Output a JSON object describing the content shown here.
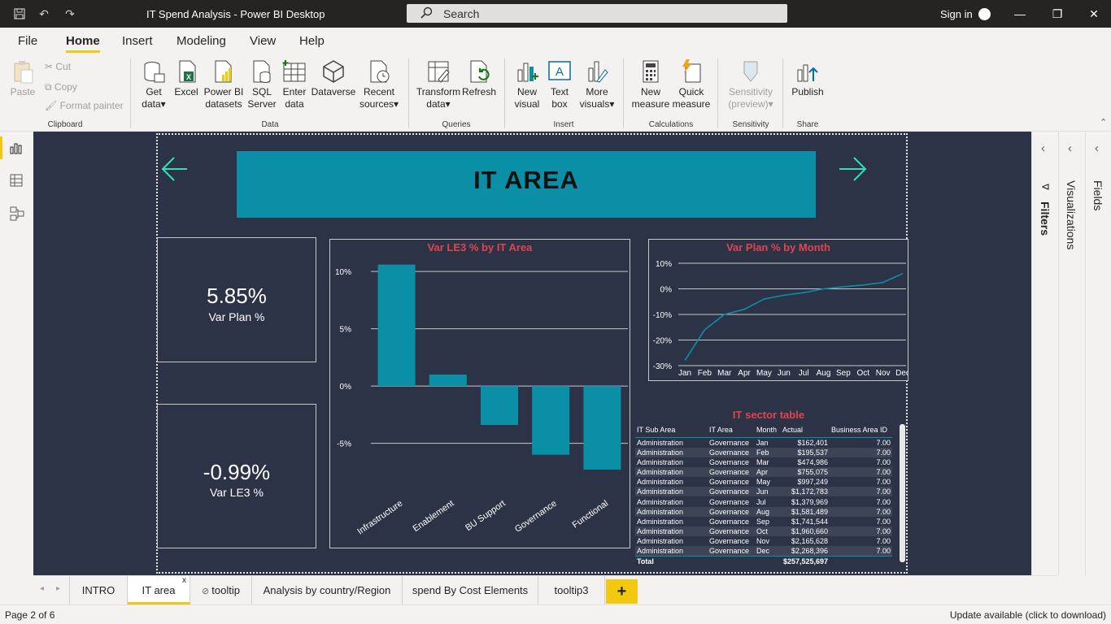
{
  "titlebar": {
    "title": "IT Spend Analysis - Power BI Desktop",
    "search_label": "Search",
    "signin_label": "Sign in"
  },
  "menu": {
    "tabs": [
      "File",
      "Home",
      "Insert",
      "Modeling",
      "View",
      "Help"
    ],
    "active": "Home"
  },
  "ribbon": {
    "clipboard": {
      "paste": "Paste",
      "cut": "Cut",
      "copy": "Copy",
      "format_painter": "Format painter",
      "group": "Clipboard"
    },
    "data": {
      "get_data": "Get data",
      "excel": "Excel",
      "pbi_datasets": "Power BI datasets",
      "sql_server": "SQL Server",
      "enter_data": "Enter data",
      "dataverse": "Dataverse",
      "recent_sources": "Recent sources",
      "group": "Data"
    },
    "queries": {
      "transform_data": "Transform data",
      "refresh": "Refresh",
      "group": "Queries"
    },
    "insert": {
      "new_visual": "New visual",
      "text_box": "Text box",
      "more_visuals": "More visuals",
      "group": "Insert"
    },
    "calculations": {
      "new_measure": "New measure",
      "quick_measure": "Quick measure",
      "group": "Calculations"
    },
    "sensitivity": {
      "label": "Sensitivity (preview)",
      "group": "Sensitivity"
    },
    "share": {
      "publish": "Publish",
      "group": "Share"
    }
  },
  "report": {
    "header_title": "IT AREA",
    "card1": {
      "value": "5.85%",
      "label": "Var Plan %"
    },
    "card2": {
      "value": "-0.99%",
      "label": "Var LE3 %"
    },
    "bar_title": "Var LE3 % by IT Area",
    "line_title": "Var Plan % by Month",
    "table_title": "IT  sector table",
    "accent_color": "#0b8fa6",
    "title_color": "#e0444e"
  },
  "chart_data": [
    {
      "type": "bar",
      "title": "Var LE3 % by IT Area",
      "categories": [
        "Infrastructure",
        "Enablement",
        "BU Support",
        "Governance",
        "Functional"
      ],
      "values": [
        10.6,
        1.0,
        -3.4,
        -6.0,
        -7.3
      ],
      "y_ticks": [
        "10%",
        "5%",
        "0%",
        "-5%"
      ],
      "ylim": [
        -9,
        11
      ]
    },
    {
      "type": "line",
      "title": "Var Plan % by Month",
      "categories": [
        "Jan",
        "Feb",
        "Mar",
        "Apr",
        "May",
        "Jun",
        "Jul",
        "Aug",
        "Sep",
        "Oct",
        "Nov",
        "Dec"
      ],
      "values": [
        -28,
        -16,
        -10,
        -8,
        -4,
        -2.5,
        -1.5,
        0,
        0.8,
        1.5,
        2.5,
        6
      ],
      "y_ticks": [
        "10%",
        "0%",
        "-10%",
        "-20%",
        "-30%"
      ],
      "ylim": [
        -30,
        10
      ]
    }
  ],
  "table": {
    "columns": [
      "IT Sub Area",
      "IT Area",
      "Month",
      "Actual",
      "Business Area ID"
    ],
    "rows": [
      [
        "Administration",
        "Governance",
        "Jan",
        "$162,401",
        "7.00"
      ],
      [
        "Administration",
        "Governance",
        "Feb",
        "$195,537",
        "7.00"
      ],
      [
        "Administration",
        "Governance",
        "Mar",
        "$474,986",
        "7.00"
      ],
      [
        "Administration",
        "Governance",
        "Apr",
        "$755,075",
        "7.00"
      ],
      [
        "Administration",
        "Governance",
        "May",
        "$997,249",
        "7.00"
      ],
      [
        "Administration",
        "Governance",
        "Jun",
        "$1,172,783",
        "7.00"
      ],
      [
        "Administration",
        "Governance",
        "Jul",
        "$1,379,969",
        "7.00"
      ],
      [
        "Administration",
        "Governance",
        "Aug",
        "$1,581,489",
        "7.00"
      ],
      [
        "Administration",
        "Governance",
        "Sep",
        "$1,741,544",
        "7.00"
      ],
      [
        "Administration",
        "Governance",
        "Oct",
        "$1,960,660",
        "7.00"
      ],
      [
        "Administration",
        "Governance",
        "Nov",
        "$2,165,628",
        "7.00"
      ],
      [
        "Administration",
        "Governance",
        "Dec",
        "$2,268,396",
        "7.00"
      ]
    ],
    "total_label": "Total",
    "total_value": "$257,525,697"
  },
  "panes": {
    "filters": "Filters",
    "visualizations": "Visualizations",
    "fields": "Fields"
  },
  "page_tabs": [
    "INTRO",
    "IT area",
    "tooltip",
    "Analysis by country/Region",
    "spend By Cost Elements",
    "tooltip3"
  ],
  "active_page_tab": "IT area",
  "status": {
    "page": "Page 2 of 6",
    "update": "Update available (click to download)"
  }
}
